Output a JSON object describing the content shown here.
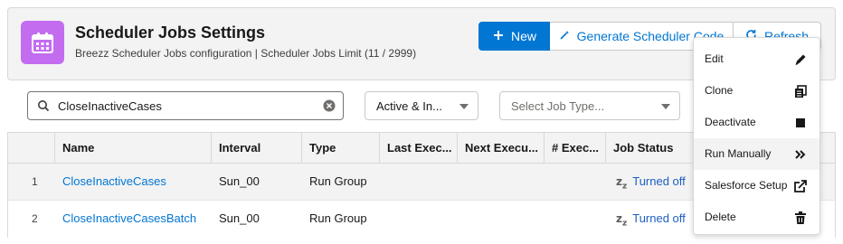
{
  "header": {
    "title": "Scheduler Jobs Settings",
    "subtitle": "Breezz Scheduler Jobs configuration | Scheduler Jobs Limit (11 / 2999)",
    "icon": "calendar-icon",
    "icon_color": "#c36cf0"
  },
  "actions": {
    "new_label": "New",
    "generate_label": "Generate Scheduler Code",
    "refresh_label": "Refresh"
  },
  "filters": {
    "search_value": "CloseInactiveCases",
    "status_value": "Active & In...",
    "type_placeholder": "Select Job Type..."
  },
  "table": {
    "columns": [
      "Name",
      "Interval",
      "Type",
      "Last Exec...",
      "Next Execu...",
      "# Exec...",
      "Job Status"
    ],
    "rows": [
      {
        "num": "1",
        "name": "CloseInactiveCases",
        "interval": "Sun_00",
        "type": "Run Group",
        "status": "Turned off"
      },
      {
        "num": "2",
        "name": "CloseInactiveCasesBatch",
        "interval": "Sun_00",
        "type": "Run Group",
        "status": "Turned off"
      }
    ]
  },
  "menu": {
    "items": [
      {
        "label": "Edit",
        "icon": "pencil-icon"
      },
      {
        "label": "Clone",
        "icon": "copy-icon"
      },
      {
        "label": "Deactivate",
        "icon": "stop-icon"
      },
      {
        "label": "Run Manually",
        "icon": "chevron-double-right-icon"
      },
      {
        "label": "Salesforce Setup",
        "icon": "external-link-icon"
      },
      {
        "label": "Delete",
        "icon": "trash-icon"
      }
    ]
  },
  "colors": {
    "brand": "#0176d3",
    "header_bg": "#f3f3f3"
  }
}
